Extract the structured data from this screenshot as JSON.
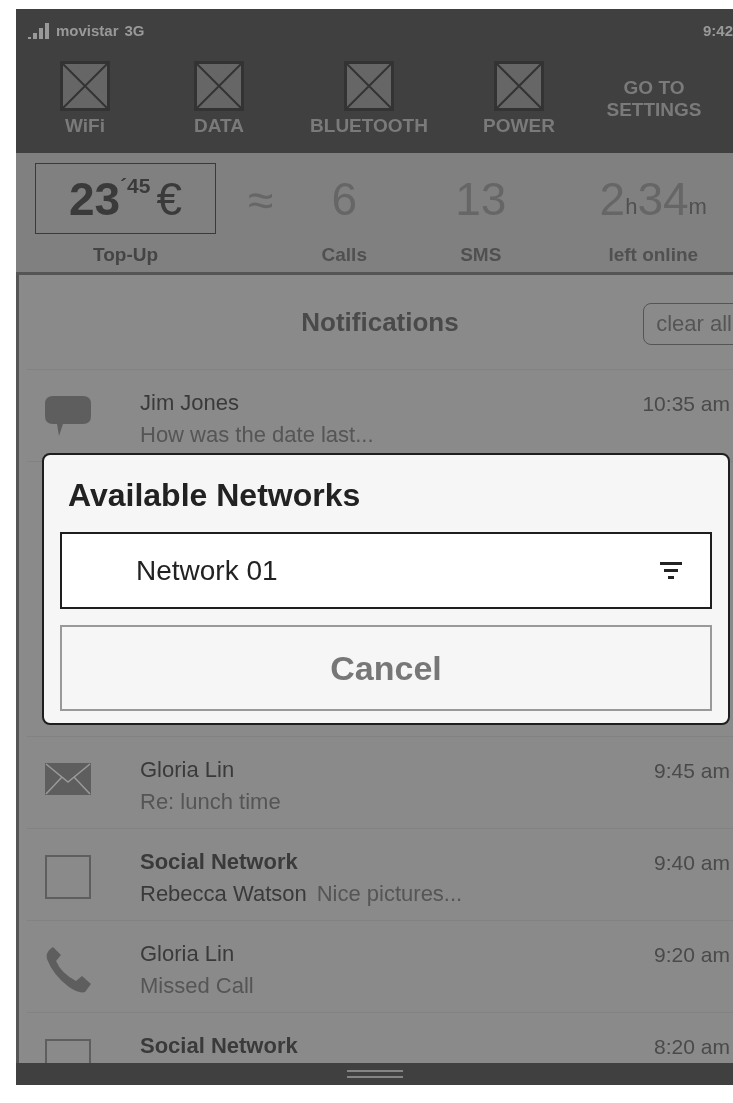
{
  "status_bar": {
    "carrier": "movistar",
    "network": "3G",
    "time": "9:42"
  },
  "toggles": [
    {
      "label": "WiFi"
    },
    {
      "label": "DATA"
    },
    {
      "label": "BLUETOOTH"
    },
    {
      "label": "POWER"
    }
  ],
  "settings_link": "GO TO SETTINGS",
  "balance": {
    "whole": "23",
    "separator": "´",
    "cents": "45",
    "currency": "€",
    "label": "Top-Up"
  },
  "approx": "≈",
  "stats": [
    {
      "kind": "count",
      "value": "6",
      "label": "Calls"
    },
    {
      "kind": "count",
      "value": "13",
      "label": "SMS"
    },
    {
      "kind": "duration",
      "hours": "2",
      "hours_unit": "h",
      "minutes": "34",
      "minutes_unit": "m",
      "label": "left online"
    }
  ],
  "notifications": {
    "title": "Notifications",
    "clear_button": "clear all",
    "items": [
      {
        "kind": "chat",
        "title": "Jim Jones",
        "text": "How was the date last...",
        "time": "10:35 am"
      },
      {
        "kind": "covered"
      },
      {
        "kind": "mail",
        "title": "Gloria Lin",
        "text": "Re: lunch time",
        "time": "9:45 am"
      },
      {
        "kind": "social",
        "title": "Social Network",
        "author": "Rebecca Watson",
        "text": "Nice pictures...",
        "time": "9:40 am"
      },
      {
        "kind": "phone",
        "title": "Gloria Lin",
        "text": "Missed Call",
        "time": "9:20 am"
      },
      {
        "kind": "social",
        "title": "Social Network",
        "time": "8:20 am"
      }
    ]
  },
  "dialog": {
    "title": "Available Networks",
    "selected_network": "Network 01",
    "cancel": "Cancel"
  }
}
